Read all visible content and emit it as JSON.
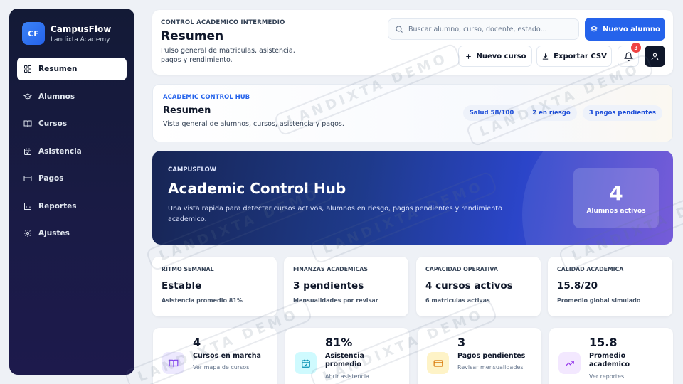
{
  "brand": {
    "logo": "CF",
    "name": "CampusFlow",
    "subtitle": "Landixta Academy"
  },
  "sidebar": {
    "items": [
      {
        "label": "Resumen",
        "icon": "grid-icon",
        "active": true
      },
      {
        "label": "Alumnos",
        "icon": "graduation-cap-icon",
        "active": false
      },
      {
        "label": "Cursos",
        "icon": "book-icon",
        "active": false
      },
      {
        "label": "Asistencia",
        "icon": "calendar-icon",
        "active": false
      },
      {
        "label": "Pagos",
        "icon": "credit-card-icon",
        "active": false
      },
      {
        "label": "Reportes",
        "icon": "bar-chart-icon",
        "active": false
      },
      {
        "label": "Ajustes",
        "icon": "gear-icon",
        "active": false
      }
    ]
  },
  "header": {
    "eyebrow": "CONTROL ACADEMICO INTERMEDIO",
    "title": "Resumen",
    "description": "Pulso general de matriculas, asistencia, pagos y rendimiento.",
    "search_placeholder": "Buscar alumno, curso, docente, estado...",
    "primary_button": "Nuevo alumno",
    "new_course_button": "Nuevo curso",
    "export_button": "Exportar CSV",
    "notifications_count": "3"
  },
  "hub": {
    "eyebrow": "ACADEMIC CONTROL HUB",
    "title": "Resumen",
    "description": "Vista general de alumnos, cursos, asistencia y pagos.",
    "pills": [
      "Salud 58/100",
      "2 en riesgo",
      "3 pagos pendientes"
    ]
  },
  "hero": {
    "eyebrow": "CAMPUSFLOW",
    "title": "Academic Control Hub",
    "description": "Una vista rapida para detectar cursos activos, alumnos en riesgo, pagos pendientes y rendimiento academico.",
    "stat_value": "4",
    "stat_label": "Alumnos activos"
  },
  "kpis": [
    {
      "label": "RITMO SEMANAL",
      "value": "Estable",
      "sub": "Asistencia promedio 81%"
    },
    {
      "label": "FINANZAS ACADEMICAS",
      "value": "3 pendientes",
      "sub": "Mensualidades por revisar"
    },
    {
      "label": "CAPACIDAD OPERATIVA",
      "value": "4 cursos activos",
      "sub": "6 matriculas activas"
    },
    {
      "label": "CALIDAD ACADEMICA",
      "value": "15.8/20",
      "sub": "Promedio global simulado"
    }
  ],
  "stats": [
    {
      "value": "4",
      "label": "Cursos en marcha",
      "sub": "Ver mapa de cursos",
      "icon": "book-icon",
      "color": "#ede9fe",
      "icon_color": "#7c3aed"
    },
    {
      "value": "81%",
      "label": "Asistencia promedio",
      "sub": "Abrir asistencia",
      "icon": "calendar-icon",
      "color": "#cffafe",
      "icon_color": "#0891b2"
    },
    {
      "value": "3",
      "label": "Pagos pendientes",
      "sub": "Revisar mensualidades",
      "icon": "credit-card-icon",
      "color": "#fef3c7",
      "icon_color": "#d97706"
    },
    {
      "value": "15.8",
      "label": "Promedio academico",
      "sub": "Ver reportes",
      "icon": "trending-up-icon",
      "color": "#f3e8ff",
      "icon_color": "#9333ea"
    }
  ],
  "watermark": "LANDIXTA DEMO"
}
